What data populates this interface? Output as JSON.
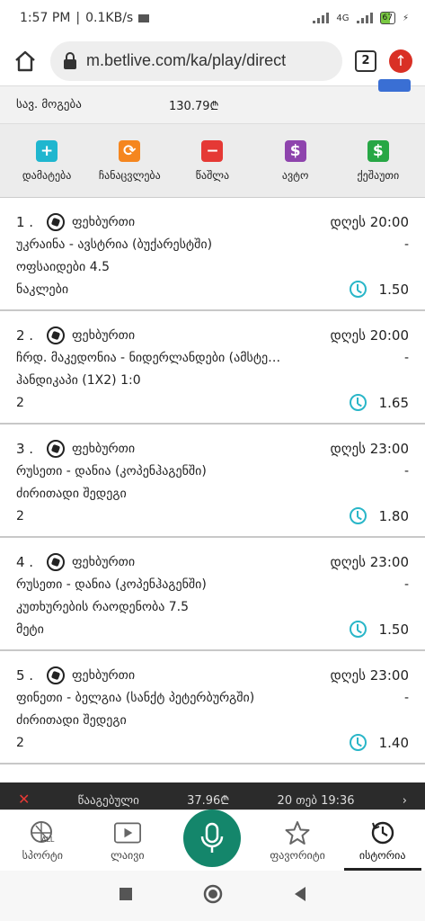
{
  "status_bar": {
    "time": "1:57 PM",
    "speed": "0.1KB/s",
    "network": "4G",
    "battery": "67"
  },
  "browser": {
    "url": "m.betlive.com/ka/play/direct",
    "tabs_count": "2"
  },
  "summary": {
    "label": "სავ. მოგება",
    "value": "130.79₾"
  },
  "actions": [
    {
      "label": "დამატება",
      "icon": "plus-icon",
      "color": "#1fb6cf",
      "glyph": "+"
    },
    {
      "label": "ჩანაცვლება",
      "icon": "swap-icon",
      "color": "#f5861f",
      "glyph": "⟳"
    },
    {
      "label": "წაშლა",
      "icon": "minus-icon",
      "color": "#e53935",
      "glyph": "−"
    },
    {
      "label": "ავტო",
      "icon": "dollar-icon",
      "color": "#8e44ad",
      "glyph": "$"
    },
    {
      "label": "ქეშაუთი",
      "icon": "dollar-icon",
      "color": "#27a745",
      "glyph": "$"
    }
  ],
  "bets": [
    {
      "num": "1 .",
      "sport": "ფეხბურთი",
      "time": "დღეს 20:00",
      "event": "უკრაინა - ავსტრია (ბუქარესტში)",
      "dash": "-",
      "market": "ოფსაიდები 4.5",
      "pick": "ნაკლები",
      "odd": "1.50"
    },
    {
      "num": "2 .",
      "sport": "ფეხბურთი",
      "time": "დღეს 20:00",
      "event": "ჩრდ. მაკედონია - ნიდერლანდები (ამსტე…",
      "dash": "-",
      "market": "ჰანდიკაპი (1X2) 1:0",
      "pick": "2",
      "odd": "1.65"
    },
    {
      "num": "3 .",
      "sport": "ფეხბურთი",
      "time": "დღეს 23:00",
      "event": "რუსეთი - დანია (კოპენჰაგენში)",
      "dash": "-",
      "market": "ძირითადი შედეგი",
      "pick": "2",
      "odd": "1.80"
    },
    {
      "num": "4 .",
      "sport": "ფეხბურთი",
      "time": "დღეს 23:00",
      "event": "რუსეთი - დანია (კოპენჰაგენში)",
      "dash": "-",
      "market": "კუთხურების რაოდენობა 7.5",
      "pick": "მეტი",
      "odd": "1.50"
    },
    {
      "num": "5 .",
      "sport": "ფეხბურთი",
      "time": "დღეს 23:00",
      "event": "ფინეთი - ბელგია (სანქტ პეტერბურგში)",
      "dash": "-",
      "market": "ძირითადი შედეგი",
      "pick": "2",
      "odd": "1.40"
    }
  ],
  "strip": {
    "left": "წააგებული",
    "amount": "37.96₾",
    "date": "20 თებ 19:36"
  },
  "bottom_nav": [
    {
      "label": "სპორტი",
      "icon": "ball-icon"
    },
    {
      "label": "ლაივი",
      "icon": "play-icon"
    },
    {
      "label": "",
      "icon": "mic-icon"
    },
    {
      "label": "ფავორიტი",
      "icon": "star-icon"
    },
    {
      "label": "ისტორია",
      "icon": "history-icon"
    }
  ]
}
